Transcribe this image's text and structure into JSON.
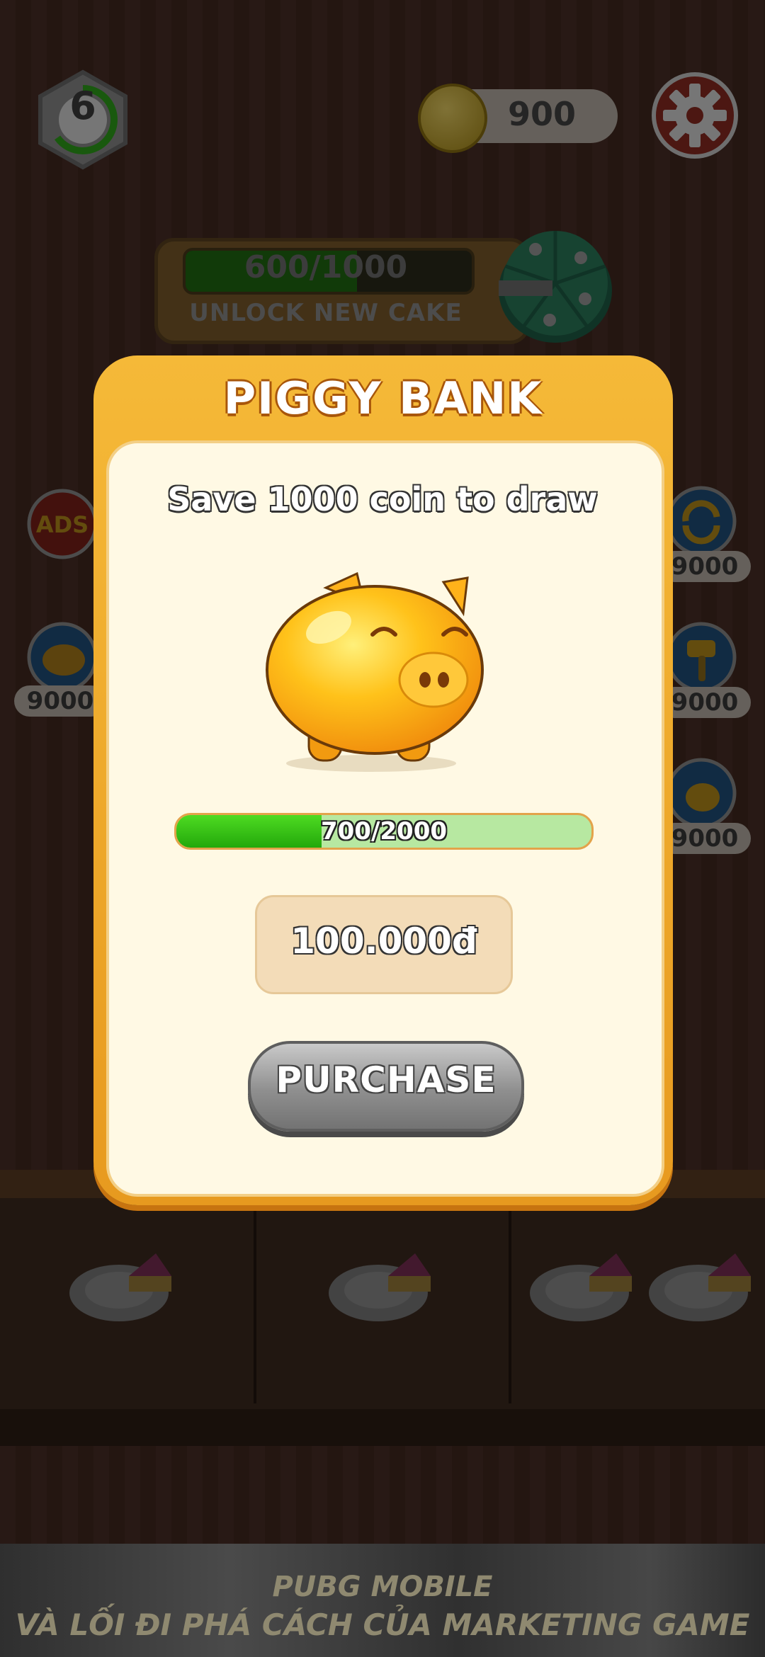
{
  "hud": {
    "level": "6",
    "coins": "900"
  },
  "unlock": {
    "progress_text": "600/1000",
    "progress_fraction": 0.6,
    "label": "UNLOCK NEW CAKE"
  },
  "side_buttons": {
    "left": [
      {
        "icon": "ads-icon",
        "badge": ""
      },
      {
        "icon": "piggy-icon",
        "badge": "9000"
      }
    ],
    "right": [
      {
        "icon": "refresh-icon",
        "badge": "9000"
      },
      {
        "icon": "hammer-icon",
        "badge": "9000"
      },
      {
        "icon": "hand-icon",
        "badge": "9000"
      }
    ]
  },
  "dialog": {
    "title": "PIGGY BANK",
    "subtitle": "Save 1000 coin to draw",
    "progress_text": "700/2000",
    "progress_fraction": 0.35,
    "price": "100.000đ",
    "purchase_label": "PURCHASE"
  },
  "ad_banner": {
    "line1": "PUBG MOBILE",
    "line2": "VÀ LỐI ĐI PHÁ CÁCH CỦA MARKETING GAME"
  },
  "colors": {
    "dialog_orange": "#f5b938",
    "dialog_cream": "#fff9e4",
    "progress_green": "#23a80b",
    "price_bg": "#f3dcb8",
    "button_gray": "#8f8f8f"
  }
}
